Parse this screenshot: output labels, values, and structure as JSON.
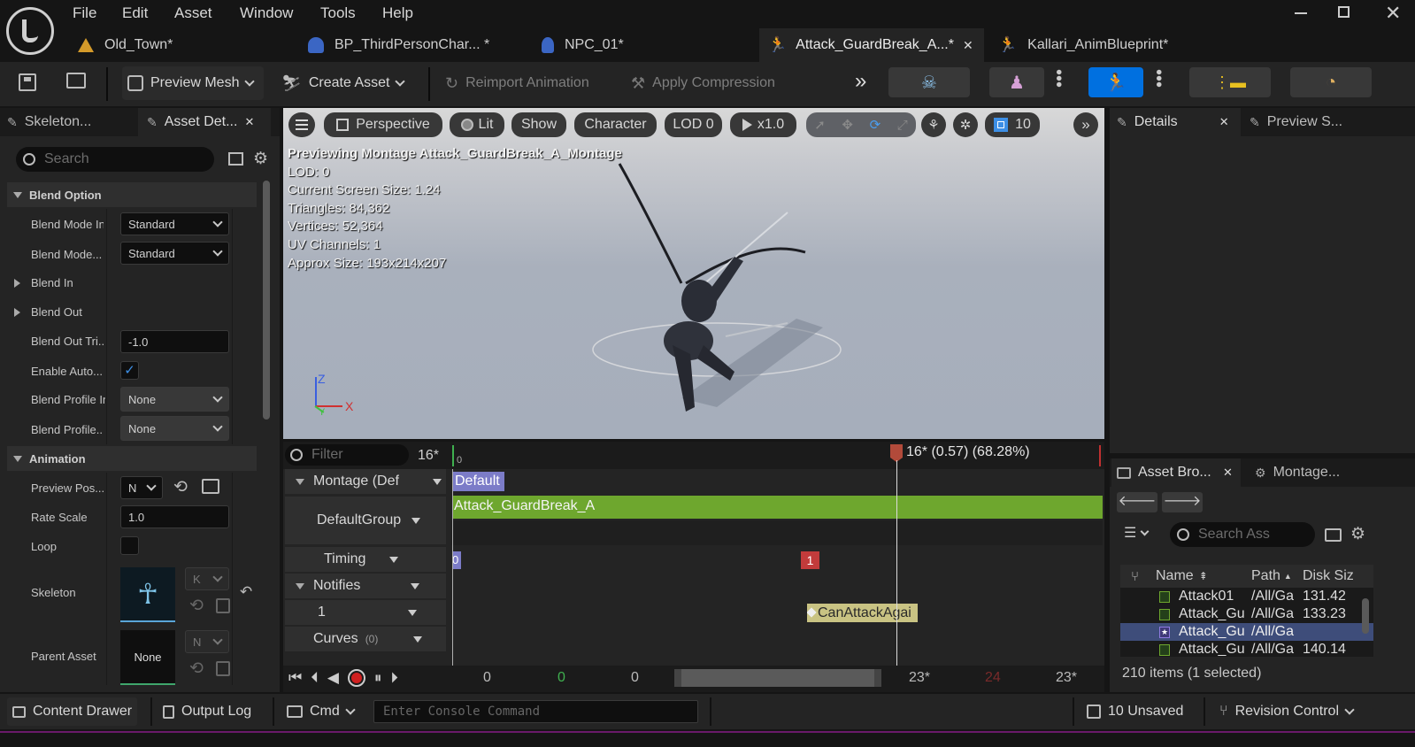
{
  "menu": {
    "items": [
      "File",
      "Edit",
      "Asset",
      "Window",
      "Tools",
      "Help"
    ]
  },
  "doc_tabs": [
    {
      "label": "Old_Town*"
    },
    {
      "label": "BP_ThirdPersonChar... *"
    },
    {
      "label": "NPC_01*"
    },
    {
      "label": "Attack_GuardBreak_A...*"
    },
    {
      "label": "Kallari_AnimBlueprint*"
    }
  ],
  "toolbar": {
    "preview_mesh": "Preview Mesh",
    "create_asset": "Create Asset",
    "reimport": "Reimport Animation",
    "apply_compression": "Apply Compression"
  },
  "left_panel": {
    "tabs": [
      "Skeleton...",
      "Asset Det..."
    ],
    "search_placeholder": "Search",
    "sections": {
      "blend_option": "Blend Option",
      "animation": "Animation"
    },
    "props": {
      "blend_mode_in": "Blend Mode In",
      "blend_mode_in_value": "Standard",
      "blend_mode_out": "Blend Mode...",
      "blend_mode_out_value": "Standard",
      "blend_in": "Blend In",
      "blend_out": "Blend Out",
      "blend_out_trigger": "Blend Out Tri...",
      "blend_out_trigger_value": "-1.0",
      "enable_auto": "Enable Auto...",
      "blend_profile_in": "Blend Profile In",
      "blend_profile_in_value": "None",
      "blend_profile_out": "Blend Profile...",
      "blend_profile_out_value": "None",
      "preview_pose": "Preview Pos...",
      "preview_pose_value": "N",
      "rate_scale": "Rate Scale",
      "rate_scale_value": "1.0",
      "loop": "Loop",
      "skeleton": "Skeleton",
      "skeleton_dd": "K",
      "parent_asset": "Parent Asset",
      "parent_asset_thumb": "None",
      "parent_asset_dd": "N"
    }
  },
  "viewport": {
    "perspective": "Perspective",
    "lit": "Lit",
    "show": "Show",
    "character": "Character",
    "lod": "LOD 0",
    "speed": "x1.0",
    "grid": "10",
    "overlay": [
      "Previewing Montage Attack_GuardBreak_A_Montage",
      "LOD: 0",
      "Current Screen Size: 1.24",
      "Triangles: 84,362",
      "Vertices: 52,364",
      "UV Channels: 1",
      "Approx Size: 193x214x207"
    ],
    "axis_z": "Z",
    "axis_x": "X",
    "axis_y": "Y"
  },
  "timeline": {
    "filter_placeholder": "Filter",
    "frame_count": "16*",
    "ruler_start": "0",
    "playhead_label": "16* (0.57) (68.28%)",
    "tracks": {
      "montage": "Montage (Def",
      "default_group": "DefaultGroup",
      "timing": "Timing",
      "notifies": "Notifies",
      "notify_track": "1",
      "curves": "Curves",
      "curves_count": "(0)"
    },
    "section_label": "Default",
    "anim_segment": "Attack_GuardBreak_A",
    "timing_marker_start": "0",
    "timing_marker": "1",
    "notify": "CanAttackAgai",
    "transport": {
      "v1": "0",
      "v2": "0",
      "v3": "0",
      "end1": "23*",
      "end2": "24",
      "end3": "23*"
    }
  },
  "details_panel": {
    "tabs": [
      "Details",
      "Preview S..."
    ]
  },
  "asset_browser": {
    "tabs": [
      "Asset Bro...",
      "Montage..."
    ],
    "search_placeholder": "Search Ass",
    "columns": [
      "Name",
      "Path",
      "Disk Siz"
    ],
    "rows": [
      {
        "name": "Attack01",
        "path": "/All/Ga",
        "size": "131.42"
      },
      {
        "name": "Attack_Gu",
        "path": "/All/Ga",
        "size": "133.23"
      },
      {
        "name": "Attack_Gu",
        "path": "/All/Ga",
        "size": ""
      },
      {
        "name": "Attack_Gu",
        "path": "/All/Ga",
        "size": "140.14"
      }
    ],
    "status": "210 items (1 selected)"
  },
  "statusbar": {
    "content_drawer": "Content Drawer",
    "output_log": "Output Log",
    "cmd": "Cmd",
    "console_placeholder": "Enter Console Command",
    "unsaved": "10 Unsaved",
    "revision_control": "Revision Control"
  },
  "colors": {
    "accent_blue": "#0070e0",
    "anim_green": "#6ea72e",
    "notify_yellow": "#c9c383",
    "timing_red": "#c23b3b",
    "section_purple": "#7c7cc8"
  }
}
